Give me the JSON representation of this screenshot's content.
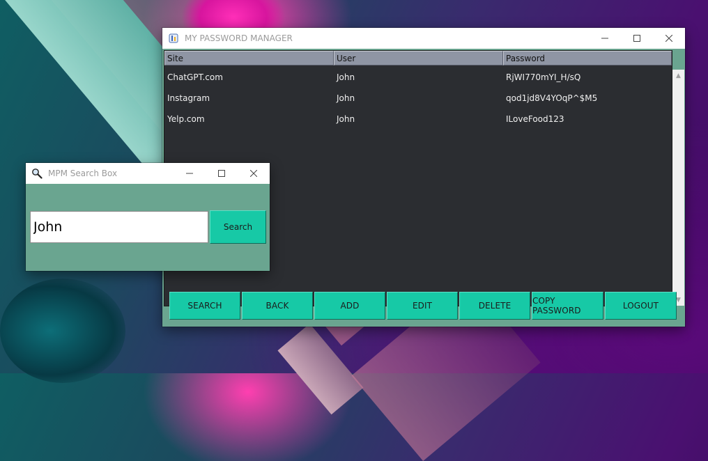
{
  "main_window": {
    "title": "MY PASSWORD MANAGER",
    "icon": "pm-app-icon",
    "controls": {
      "minimize": "minimize-icon",
      "maximize": "maximize-icon",
      "close": "close-icon"
    },
    "table": {
      "columns": [
        "Site",
        "User",
        "Password"
      ],
      "rows": [
        [
          "ChatGPT.com",
          "John",
          "RjWI770mYI_H/sQ"
        ],
        [
          "Instagram",
          "John",
          "qod1jd8V4YOqP^$M5"
        ],
        [
          "Yelp.com",
          "John",
          "ILoveFood123"
        ]
      ]
    },
    "buttons": [
      "SEARCH",
      "BACK",
      "ADD",
      "EDIT",
      "DELETE",
      "COPY PASSWORD",
      "LOGOUT"
    ]
  },
  "search_window": {
    "title": "MPM Search Box",
    "icon": "magnifier-icon",
    "input_value": "John",
    "search_label": "Search"
  },
  "colors": {
    "accent_button": "#17c9a6",
    "client_bg": "#6aa590",
    "table_bg": "#2b2d31",
    "header_bg": "#8f95a4"
  }
}
